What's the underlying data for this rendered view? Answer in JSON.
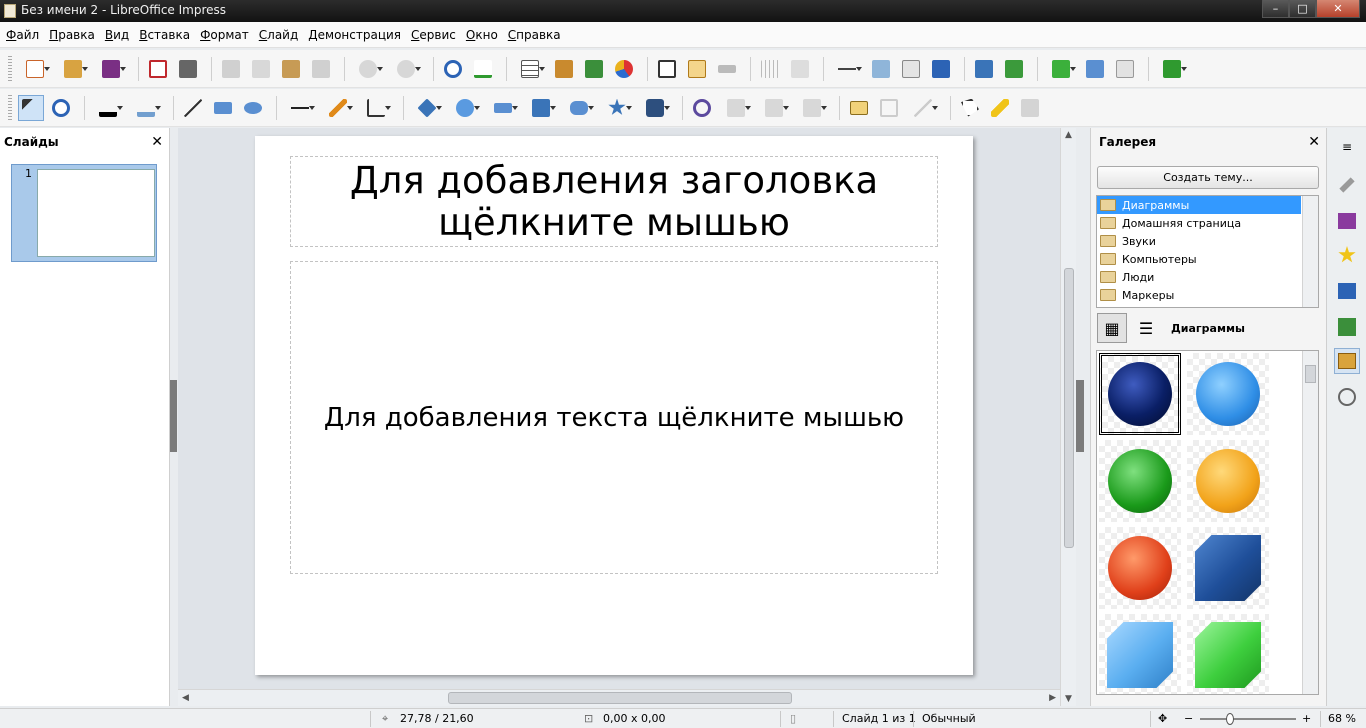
{
  "window": {
    "title": "Без имени 2 - LibreOffice Impress",
    "controls": [
      "minimize",
      "maximize",
      "close"
    ]
  },
  "menu": [
    "Файл",
    "Правка",
    "Вид",
    "Вставка",
    "Формат",
    "Слайд",
    "Демонстрация",
    "Сервис",
    "Окно",
    "Справка"
  ],
  "slides_pane": {
    "title": "Слайды",
    "close_glyph": "✕",
    "slides": [
      {
        "number": "1"
      }
    ]
  },
  "slide": {
    "title_placeholder": "Для добавления заголовка щёлкните мышью",
    "body_placeholder": "Для добавления текста щёлкните мышью"
  },
  "gallery": {
    "title": "Галерея",
    "close_glyph": "✕",
    "create_theme_label": "Создать тему...",
    "themes": [
      "Диаграммы",
      "Домашняя страница",
      "Звуки",
      "Компьютеры",
      "Люди",
      "Маркеры"
    ],
    "selected_theme": "Диаграммы",
    "caption": "Диаграммы",
    "items": [
      {
        "shape": "ball",
        "color": "#0a1f66"
      },
      {
        "shape": "ball",
        "color": "#2f8ee6"
      },
      {
        "shape": "ball",
        "color": "#1a9a1a"
      },
      {
        "shape": "ball",
        "color": "#f2a31a"
      },
      {
        "shape": "ball",
        "color": "#e0401a"
      },
      {
        "shape": "cube",
        "color": "#1f4f9a"
      },
      {
        "shape": "cube",
        "color": "#5aaef0"
      },
      {
        "shape": "cube",
        "color": "#3ecf3e"
      }
    ]
  },
  "statusbar": {
    "position": "27,78 / 21,60",
    "size": "0,00 x 0,00",
    "slide_info": "Слайд 1 из 1",
    "layout": "Обычный",
    "zoom": "68 %"
  },
  "colors": {
    "accent": "#3399ff",
    "titlebar": "#1e1e1e",
    "workspace": "#dfe3e8"
  }
}
